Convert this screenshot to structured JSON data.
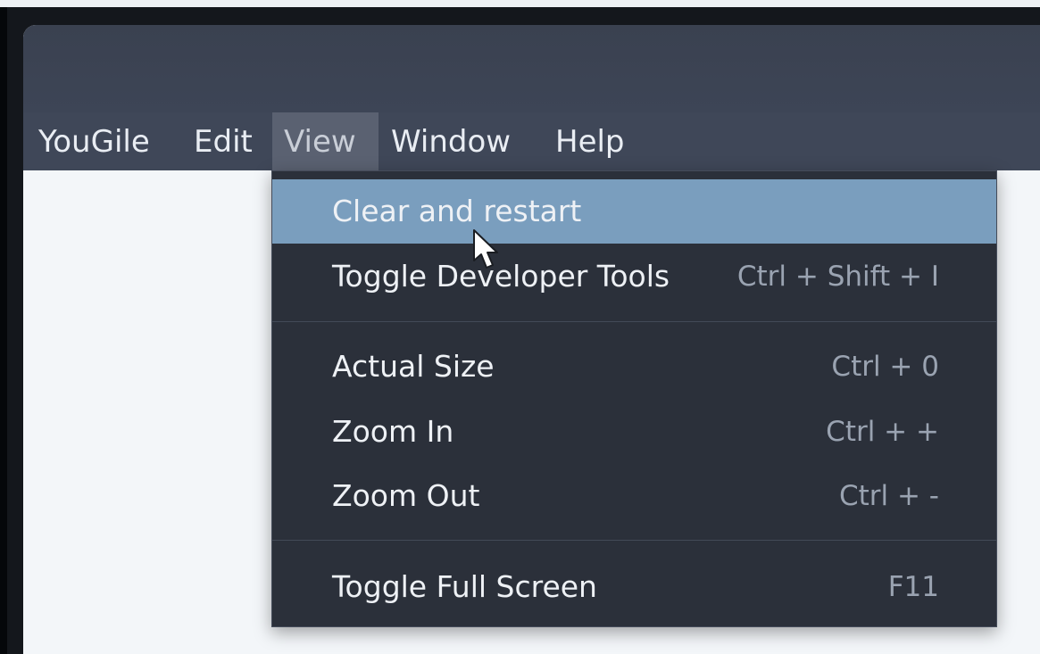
{
  "menubar": {
    "items": [
      {
        "label": "YouGile"
      },
      {
        "label": "Edit"
      },
      {
        "label": "View"
      },
      {
        "label": "Window"
      },
      {
        "label": "Help"
      }
    ]
  },
  "view_menu": {
    "items": [
      {
        "label": "Clear and restart",
        "shortcut": ""
      },
      {
        "label": "Toggle Developer Tools",
        "shortcut": "Ctrl + Shift + I"
      },
      {
        "label": "Actual Size",
        "shortcut": "Ctrl + 0"
      },
      {
        "label": "Zoom In",
        "shortcut": "Ctrl + +"
      },
      {
        "label": "Zoom Out",
        "shortcut": "Ctrl + -"
      },
      {
        "label": "Toggle Full Screen",
        "shortcut": "F11"
      }
    ]
  },
  "colors": {
    "menu_highlight": "#7a9ebe",
    "menu_background": "#2b303a",
    "menubar_background": "#3f4758"
  },
  "icons": {
    "pointer": "mouse-pointer-icon"
  }
}
